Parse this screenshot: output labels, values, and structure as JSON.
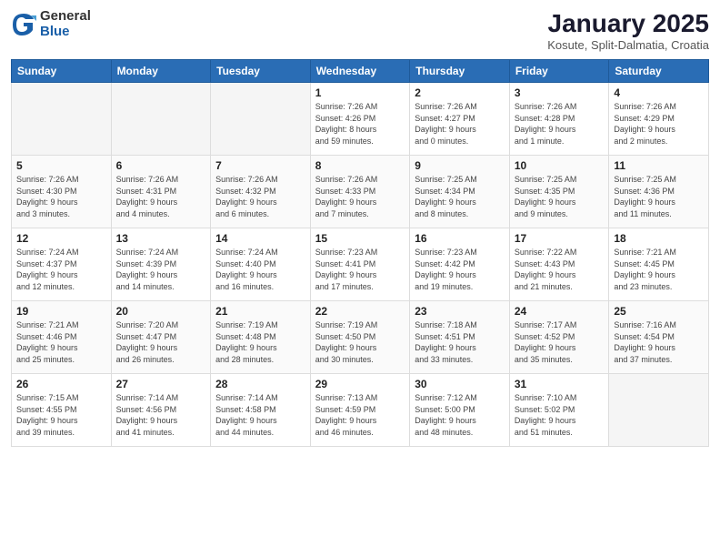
{
  "header": {
    "logo_general": "General",
    "logo_blue": "Blue",
    "month_title": "January 2025",
    "location": "Kosute, Split-Dalmatia, Croatia"
  },
  "days_of_week": [
    "Sunday",
    "Monday",
    "Tuesday",
    "Wednesday",
    "Thursday",
    "Friday",
    "Saturday"
  ],
  "weeks": [
    [
      {
        "day": "",
        "info": ""
      },
      {
        "day": "",
        "info": ""
      },
      {
        "day": "",
        "info": ""
      },
      {
        "day": "1",
        "info": "Sunrise: 7:26 AM\nSunset: 4:26 PM\nDaylight: 8 hours\nand 59 minutes."
      },
      {
        "day": "2",
        "info": "Sunrise: 7:26 AM\nSunset: 4:27 PM\nDaylight: 9 hours\nand 0 minutes."
      },
      {
        "day": "3",
        "info": "Sunrise: 7:26 AM\nSunset: 4:28 PM\nDaylight: 9 hours\nand 1 minute."
      },
      {
        "day": "4",
        "info": "Sunrise: 7:26 AM\nSunset: 4:29 PM\nDaylight: 9 hours\nand 2 minutes."
      }
    ],
    [
      {
        "day": "5",
        "info": "Sunrise: 7:26 AM\nSunset: 4:30 PM\nDaylight: 9 hours\nand 3 minutes."
      },
      {
        "day": "6",
        "info": "Sunrise: 7:26 AM\nSunset: 4:31 PM\nDaylight: 9 hours\nand 4 minutes."
      },
      {
        "day": "7",
        "info": "Sunrise: 7:26 AM\nSunset: 4:32 PM\nDaylight: 9 hours\nand 6 minutes."
      },
      {
        "day": "8",
        "info": "Sunrise: 7:26 AM\nSunset: 4:33 PM\nDaylight: 9 hours\nand 7 minutes."
      },
      {
        "day": "9",
        "info": "Sunrise: 7:25 AM\nSunset: 4:34 PM\nDaylight: 9 hours\nand 8 minutes."
      },
      {
        "day": "10",
        "info": "Sunrise: 7:25 AM\nSunset: 4:35 PM\nDaylight: 9 hours\nand 9 minutes."
      },
      {
        "day": "11",
        "info": "Sunrise: 7:25 AM\nSunset: 4:36 PM\nDaylight: 9 hours\nand 11 minutes."
      }
    ],
    [
      {
        "day": "12",
        "info": "Sunrise: 7:24 AM\nSunset: 4:37 PM\nDaylight: 9 hours\nand 12 minutes."
      },
      {
        "day": "13",
        "info": "Sunrise: 7:24 AM\nSunset: 4:39 PM\nDaylight: 9 hours\nand 14 minutes."
      },
      {
        "day": "14",
        "info": "Sunrise: 7:24 AM\nSunset: 4:40 PM\nDaylight: 9 hours\nand 16 minutes."
      },
      {
        "day": "15",
        "info": "Sunrise: 7:23 AM\nSunset: 4:41 PM\nDaylight: 9 hours\nand 17 minutes."
      },
      {
        "day": "16",
        "info": "Sunrise: 7:23 AM\nSunset: 4:42 PM\nDaylight: 9 hours\nand 19 minutes."
      },
      {
        "day": "17",
        "info": "Sunrise: 7:22 AM\nSunset: 4:43 PM\nDaylight: 9 hours\nand 21 minutes."
      },
      {
        "day": "18",
        "info": "Sunrise: 7:21 AM\nSunset: 4:45 PM\nDaylight: 9 hours\nand 23 minutes."
      }
    ],
    [
      {
        "day": "19",
        "info": "Sunrise: 7:21 AM\nSunset: 4:46 PM\nDaylight: 9 hours\nand 25 minutes."
      },
      {
        "day": "20",
        "info": "Sunrise: 7:20 AM\nSunset: 4:47 PM\nDaylight: 9 hours\nand 26 minutes."
      },
      {
        "day": "21",
        "info": "Sunrise: 7:19 AM\nSunset: 4:48 PM\nDaylight: 9 hours\nand 28 minutes."
      },
      {
        "day": "22",
        "info": "Sunrise: 7:19 AM\nSunset: 4:50 PM\nDaylight: 9 hours\nand 30 minutes."
      },
      {
        "day": "23",
        "info": "Sunrise: 7:18 AM\nSunset: 4:51 PM\nDaylight: 9 hours\nand 33 minutes."
      },
      {
        "day": "24",
        "info": "Sunrise: 7:17 AM\nSunset: 4:52 PM\nDaylight: 9 hours\nand 35 minutes."
      },
      {
        "day": "25",
        "info": "Sunrise: 7:16 AM\nSunset: 4:54 PM\nDaylight: 9 hours\nand 37 minutes."
      }
    ],
    [
      {
        "day": "26",
        "info": "Sunrise: 7:15 AM\nSunset: 4:55 PM\nDaylight: 9 hours\nand 39 minutes."
      },
      {
        "day": "27",
        "info": "Sunrise: 7:14 AM\nSunset: 4:56 PM\nDaylight: 9 hours\nand 41 minutes."
      },
      {
        "day": "28",
        "info": "Sunrise: 7:14 AM\nSunset: 4:58 PM\nDaylight: 9 hours\nand 44 minutes."
      },
      {
        "day": "29",
        "info": "Sunrise: 7:13 AM\nSunset: 4:59 PM\nDaylight: 9 hours\nand 46 minutes."
      },
      {
        "day": "30",
        "info": "Sunrise: 7:12 AM\nSunset: 5:00 PM\nDaylight: 9 hours\nand 48 minutes."
      },
      {
        "day": "31",
        "info": "Sunrise: 7:10 AM\nSunset: 5:02 PM\nDaylight: 9 hours\nand 51 minutes."
      },
      {
        "day": "",
        "info": ""
      }
    ]
  ]
}
